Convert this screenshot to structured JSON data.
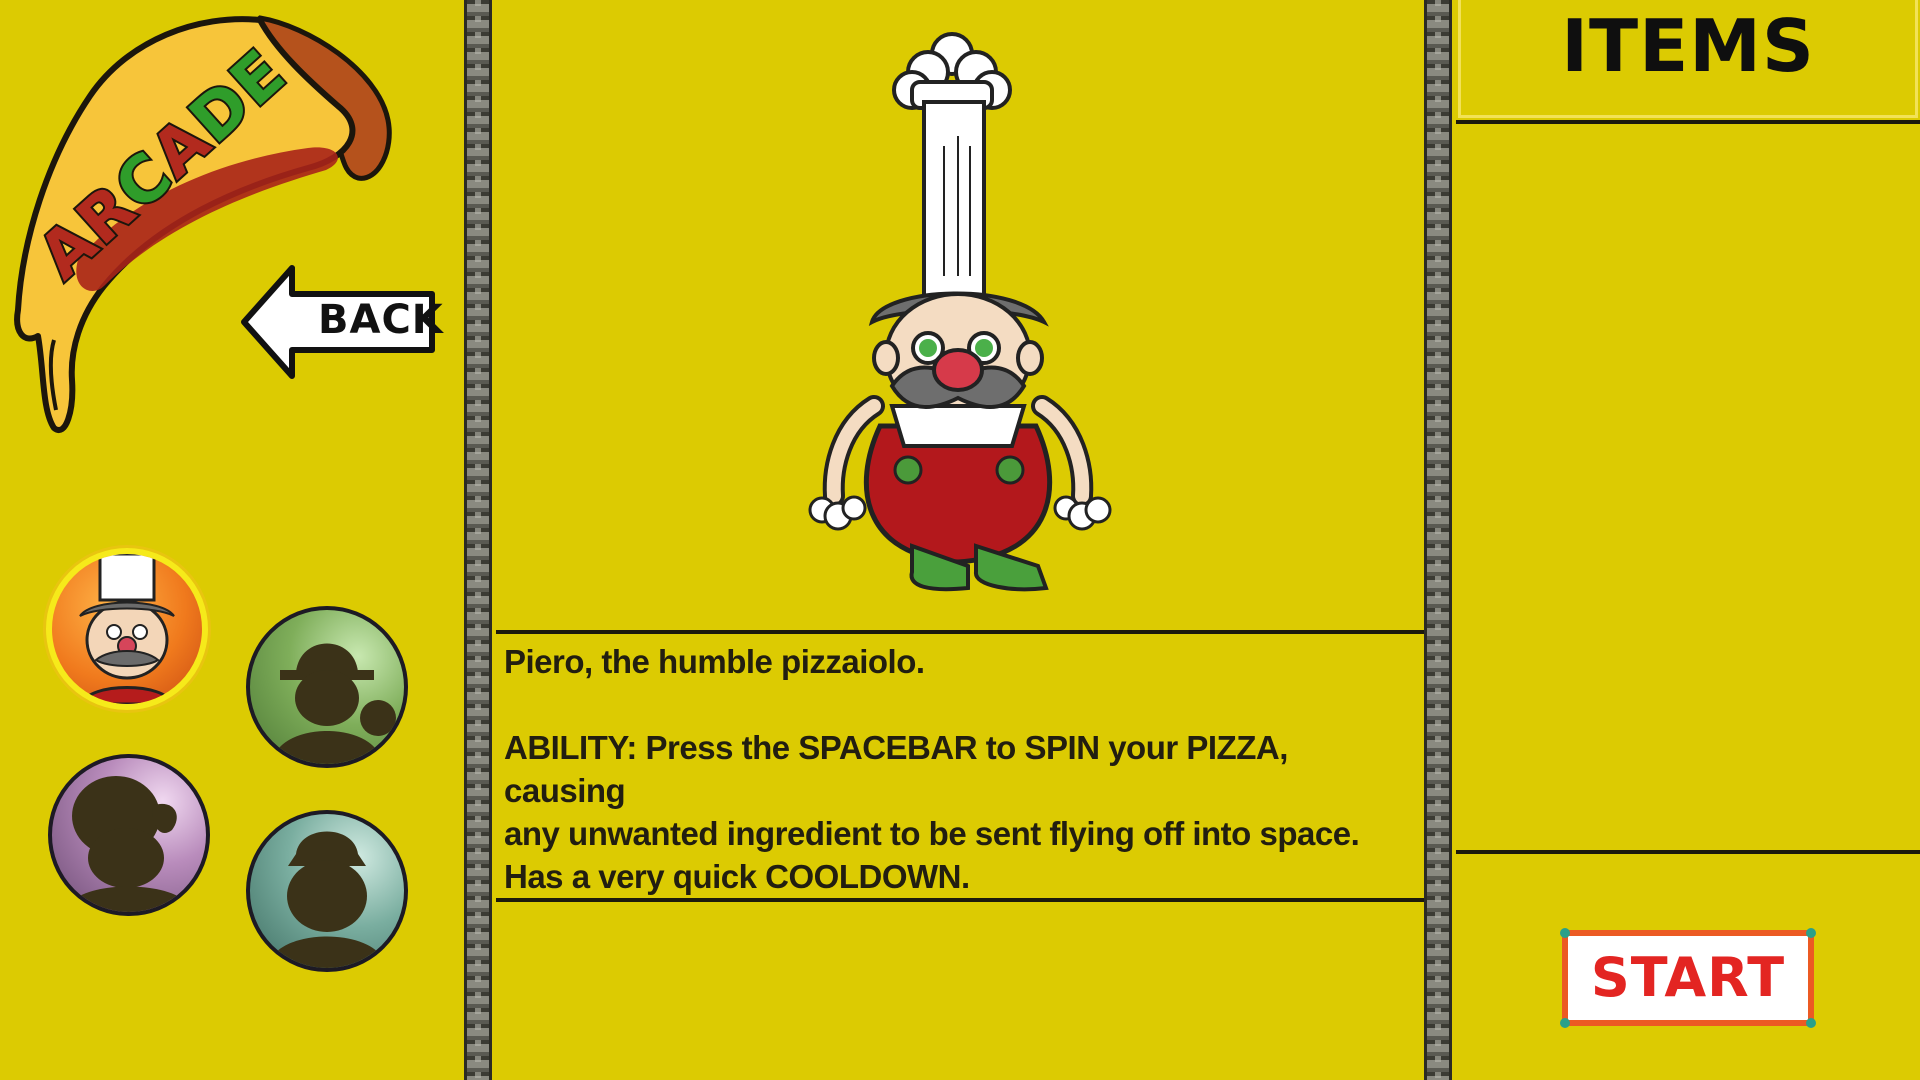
{
  "logo": {
    "text": "ARCADE"
  },
  "back_button": {
    "label": "BACK"
  },
  "characters": [
    {
      "name": "Piero",
      "status": "selected",
      "icon": "chef-portrait-icon"
    },
    {
      "name": "",
      "status": "locked",
      "icon": "detective-silhouette-icon"
    },
    {
      "name": "",
      "status": "locked",
      "icon": "character-silhouette-icon"
    },
    {
      "name": "",
      "status": "locked",
      "icon": "character-silhouette-icon"
    }
  ],
  "selected_character": {
    "tagline": "Piero, the humble pizzaiolo.",
    "ability_lines": [
      "ABILITY: Press the SPACEBAR to SPIN your PIZZA, causing",
      "any unwanted ingredient to be sent flying off into space.",
      "Has a very quick COOLDOWN."
    ]
  },
  "items_panel": {
    "title": "ITEMS"
  },
  "start_button": {
    "label": "START"
  },
  "colors": {
    "background": "#dccb02",
    "start_text": "#e32522",
    "start_border": "#ec5a23",
    "selected_ring": "#f6ea1a"
  }
}
